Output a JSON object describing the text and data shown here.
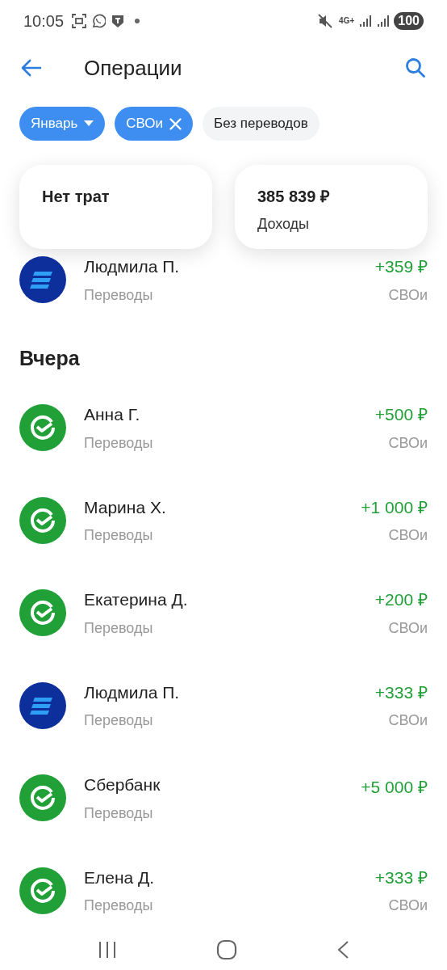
{
  "status_bar": {
    "time": "10:05",
    "network": "4G+",
    "battery": "100"
  },
  "header": {
    "title": "Операции"
  },
  "filters": [
    {
      "label": "Январь",
      "kind": "dropdown",
      "selected": true
    },
    {
      "label": "СВОи",
      "kind": "removable",
      "selected": true
    },
    {
      "label": "Без переводов",
      "kind": "plain",
      "selected": false
    }
  ],
  "summary": [
    {
      "value": "Нет трат"
    },
    {
      "value": "385 839 ₽",
      "label": "Доходы"
    }
  ],
  "sections": [
    {
      "items": [
        {
          "name": "Людмила П.",
          "category": "Переводы",
          "amount": "+359 ₽",
          "tag": "СВОи",
          "kind": "vtb"
        }
      ]
    },
    {
      "title": "Вчера",
      "items": [
        {
          "name": "Анна Г.",
          "category": "Переводы",
          "amount": "+500 ₽",
          "tag": "СВОи",
          "kind": "sber"
        },
        {
          "name": "Марина Х.",
          "category": "Переводы",
          "amount": "+1 000 ₽",
          "tag": "СВОи",
          "kind": "sber"
        },
        {
          "name": "Екатерина Д.",
          "category": "Переводы",
          "amount": "+200 ₽",
          "tag": "СВОи",
          "kind": "sber"
        },
        {
          "name": "Людмила П.",
          "category": "Переводы",
          "amount": "+333 ₽",
          "tag": "СВОи",
          "kind": "vtb"
        },
        {
          "name": "Сбербанк",
          "category": "Переводы",
          "amount": "+5 000 ₽",
          "kind": "sber"
        },
        {
          "name": "Елена Д.",
          "category": "Переводы",
          "amount": "+333 ₽",
          "tag": "СВОи",
          "kind": "sber"
        }
      ]
    }
  ]
}
